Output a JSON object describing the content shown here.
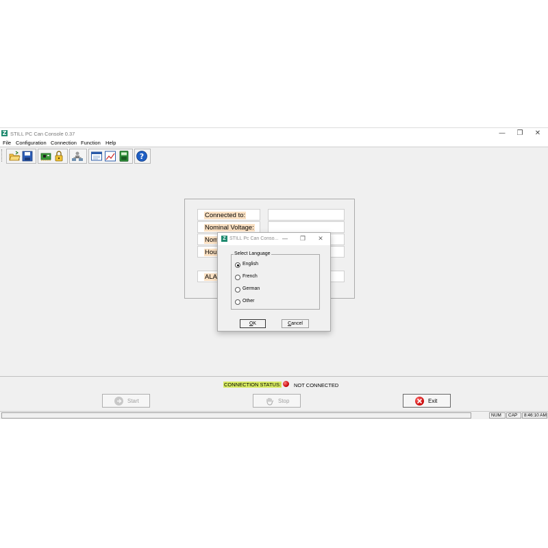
{
  "window": {
    "title": "STILL PC Can Console 0.37",
    "controls": {
      "minimize": "—",
      "maximize": "❐",
      "close": "✕"
    }
  },
  "menu": {
    "items": [
      "File",
      "Configuration",
      "Connection",
      "Function",
      "Help"
    ]
  },
  "toolbar": {
    "icons": [
      "open-folder-icon",
      "save-disk-icon",
      "circuit-board-icon",
      "padlock-icon",
      "network-users-icon",
      "terminal-window-icon",
      "chart-icon",
      "calculator-icon",
      "help-icon"
    ]
  },
  "info_panel": {
    "labels": [
      "Connected to:",
      "Nominal Voltage:",
      "Nom",
      "Hour",
      "ALA"
    ],
    "values": [
      "",
      "",
      "",
      "",
      ""
    ]
  },
  "connection": {
    "status_label": "CONNECTION STATUS:",
    "status_value": "NOT CONNECTED",
    "led_color": "#d00000"
  },
  "buttons": {
    "start": "Start",
    "stop": "Stop",
    "exit": "Exit"
  },
  "statusbar": {
    "num": "NUM",
    "cap": "CAP",
    "time": "8:46:10 AM"
  },
  "dialog": {
    "title": "STILL Pc Can Conso...",
    "group_label": "Select Language",
    "options": [
      "English",
      "French",
      "German",
      "Other"
    ],
    "selected": "English",
    "ok_label": "OK",
    "cancel_label": "Cancel"
  },
  "colors": {
    "label_highlight": "#fbe1c3",
    "status_highlight": "#d9ec63",
    "app_icon": "#1f8a6f"
  }
}
